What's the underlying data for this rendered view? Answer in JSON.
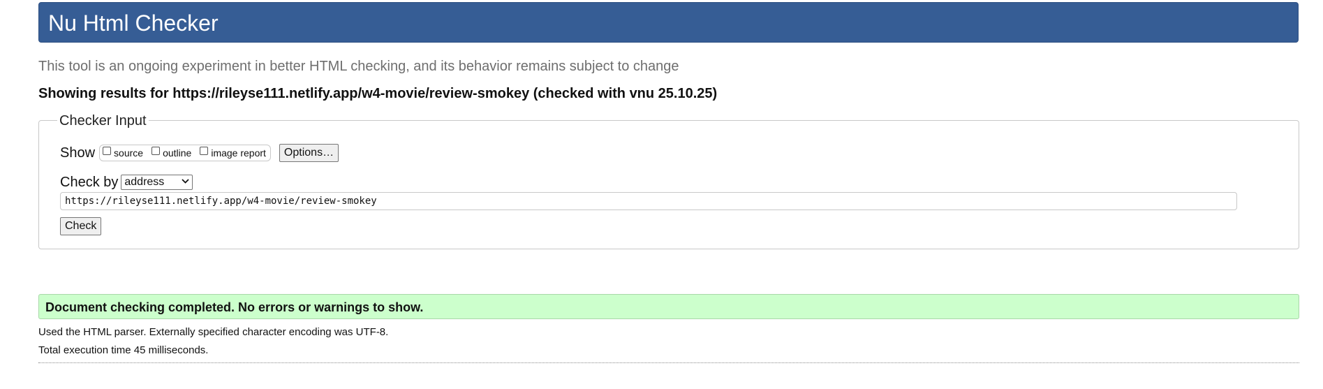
{
  "header": {
    "title": "Nu Html Checker"
  },
  "tagline": "This tool is an ongoing experiment in better HTML checking, and its behavior remains subject to change",
  "results_heading": "Showing results for https://rileyse111.netlify.app/w4-movie/review-smokey (checked with vnu 25.10.25)",
  "checker_input": {
    "legend": "Checker Input",
    "show_label": "Show",
    "show_options": [
      {
        "label": "source",
        "checked": false
      },
      {
        "label": "outline",
        "checked": false
      },
      {
        "label": "image report",
        "checked": false
      }
    ],
    "options_button": "Options…",
    "check_by_label": "Check by",
    "check_by_selected": "address",
    "url_value": "https://rileyse111.netlify.app/w4-movie/review-smokey",
    "check_button": "Check"
  },
  "result": {
    "message": "Document checking completed. No errors or warnings to show.",
    "parser_info": "Used the HTML parser. Externally specified character encoding was UTF-8.",
    "execution_time": "Total execution time 45 milliseconds."
  },
  "colors": {
    "header_bg": "#365d95",
    "success_bg": "#ccffcc",
    "tagline_text": "#6e6e6e"
  },
  "icons": {
    "select_arrow": "chevron-down-icon"
  }
}
